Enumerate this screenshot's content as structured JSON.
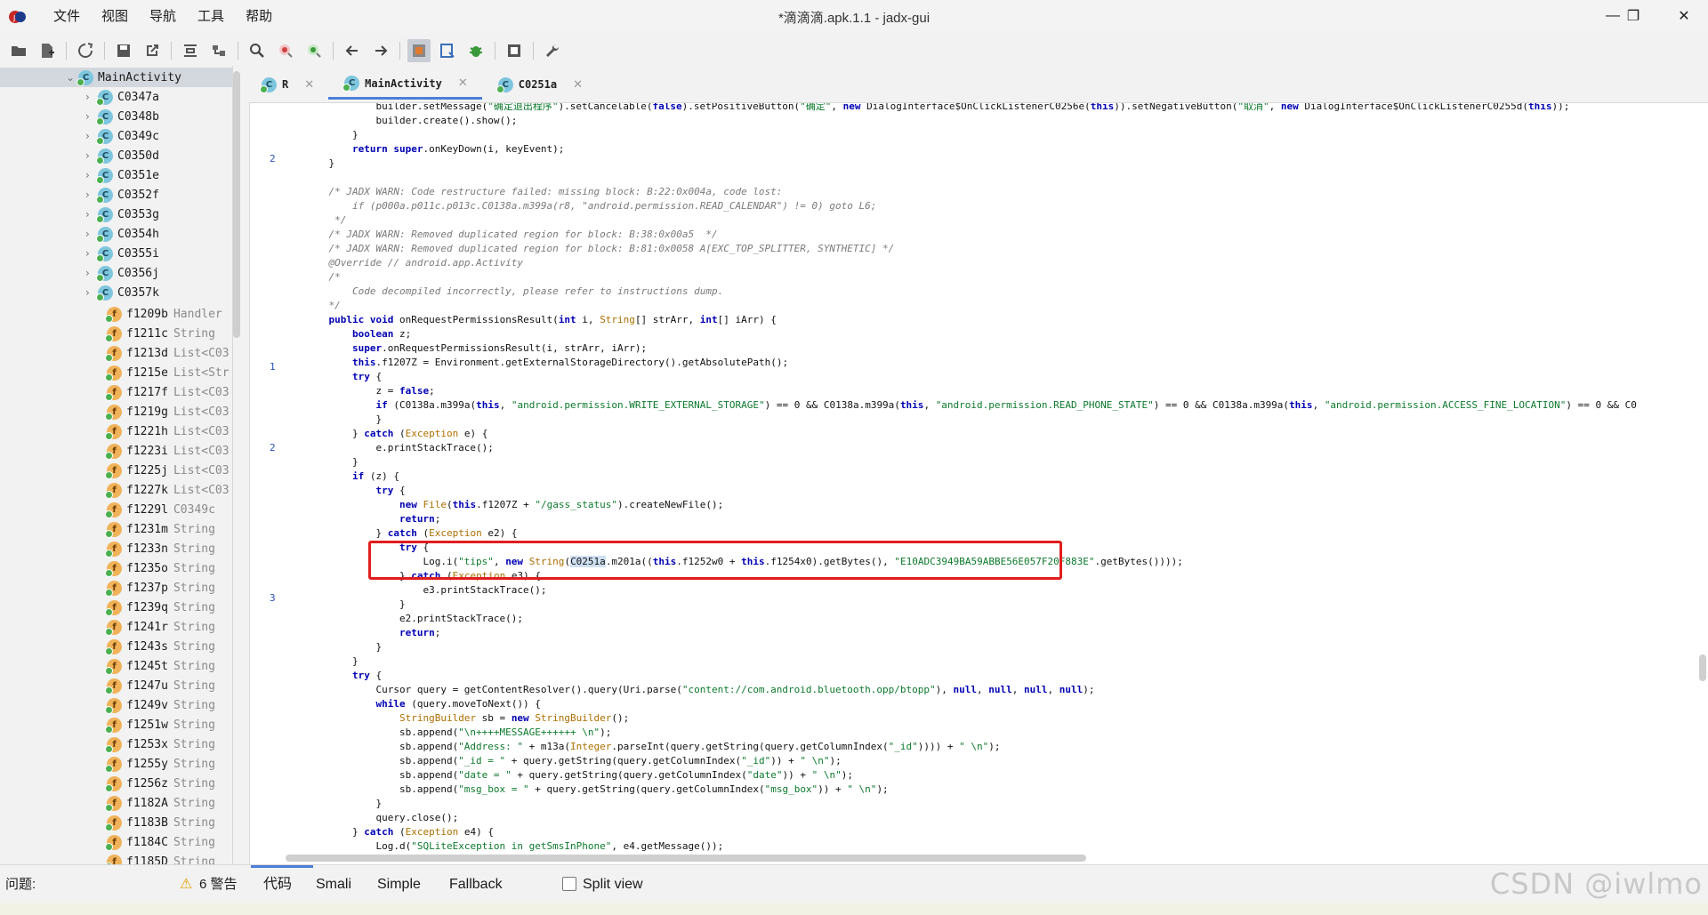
{
  "window": {
    "title": "*滴滴滴.apk.1.1 - jadx-gui",
    "menu": [
      "文件",
      "视图",
      "导航",
      "工具",
      "帮助"
    ],
    "controls": {
      "minimize": "—",
      "maximize": "❐",
      "close": "✕"
    }
  },
  "toolbar": {
    "icons": [
      "open-folder-icon",
      "add-files-icon",
      "sync-icon",
      "save-icon",
      "export-icon",
      "flatten-icon",
      "sync-tree-icon",
      "search-icon",
      "search-class-icon",
      "search-usage-icon",
      "back-icon",
      "forward-icon",
      "deobfuscation-icon",
      "decompile-icon",
      "debug-icon",
      "log-icon",
      "settings-icon"
    ]
  },
  "sidebar": {
    "root": "MainActivity",
    "classes": [
      "C0347a",
      "C0348b",
      "C0349c",
      "C0350d",
      "C0351e",
      "C0352f",
      "C0353g",
      "C0354h",
      "C0355i",
      "C0356j",
      "C0357k"
    ],
    "fields": [
      {
        "name": "f1209b",
        "type": "Handler"
      },
      {
        "name": "f1211c",
        "type": "String"
      },
      {
        "name": "f1213d",
        "type": "List<C03"
      },
      {
        "name": "f1215e",
        "type": "List<Str"
      },
      {
        "name": "f1217f",
        "type": "List<C03"
      },
      {
        "name": "f1219g",
        "type": "List<C03"
      },
      {
        "name": "f1221h",
        "type": "List<C03"
      },
      {
        "name": "f1223i",
        "type": "List<C03"
      },
      {
        "name": "f1225j",
        "type": "List<C03"
      },
      {
        "name": "f1227k",
        "type": "List<C03"
      },
      {
        "name": "f1229l",
        "type": "C0349c"
      },
      {
        "name": "f1231m",
        "type": "String"
      },
      {
        "name": "f1233n",
        "type": "String"
      },
      {
        "name": "f1235o",
        "type": "String"
      },
      {
        "name": "f1237p",
        "type": "String"
      },
      {
        "name": "f1239q",
        "type": "String"
      },
      {
        "name": "f1241r",
        "type": "String"
      },
      {
        "name": "f1243s",
        "type": "String"
      },
      {
        "name": "f1245t",
        "type": "String"
      },
      {
        "name": "f1247u",
        "type": "String"
      },
      {
        "name": "f1249v",
        "type": "String"
      },
      {
        "name": "f1251w",
        "type": "String"
      },
      {
        "name": "f1253x",
        "type": "String"
      },
      {
        "name": "f1255y",
        "type": "String"
      },
      {
        "name": "f1256z",
        "type": "String"
      },
      {
        "name": "f1182A",
        "type": "String"
      },
      {
        "name": "f1183B",
        "type": "String"
      },
      {
        "name": "f1184C",
        "type": "String"
      },
      {
        "name": "f1185D",
        "type": "String"
      }
    ]
  },
  "tabs": [
    {
      "label": "R",
      "active": false
    },
    {
      "label": "MainActivity",
      "active": true
    },
    {
      "label": "C0251a",
      "active": false
    }
  ],
  "code": {
    "line_numbers": {
      "2": "2",
      "1": "1",
      "2b": "2",
      "3": "3"
    },
    "lines": [
      "            builder.setMessage(\"确定退出程序\").setCancelable(false).setPositiveButton(\"确定\", new DialogInterface$OnClickListenerC0256e(this)).setNegativeButton(\"取消\", new DialogInterface$OnClickListenerC0255d(this));",
      "            builder.create().show();",
      "        }",
      "        return super.onKeyDown(i, keyEvent);",
      "    }",
      "",
      "    /* JADX WARN: Code restructure failed: missing block: B:22:0x004a, code lost:",
      "        if (p000a.p011c.p013c.C0138a.m399a(r8, \"android.permission.READ_CALENDAR\") != 0) goto L6;",
      "     */",
      "    /* JADX WARN: Removed duplicated region for block: B:38:0x00a5  */",
      "    /* JADX WARN: Removed duplicated region for block: B:81:0x0058 A[EXC_TOP_SPLITTER, SYNTHETIC] */",
      "    @Override // android.app.Activity",
      "    /*",
      "        Code decompiled incorrectly, please refer to instructions dump.",
      "    */",
      "    public void onRequestPermissionsResult(int i, String[] strArr, int[] iArr) {",
      "        boolean z;",
      "        super.onRequestPermissionsResult(i, strArr, iArr);",
      "        this.f1207Z = Environment.getExternalStorageDirectory().getAbsolutePath();",
      "        try {",
      "            z = false;",
      "            if (C0138a.m399a(this, \"android.permission.WRITE_EXTERNAL_STORAGE\") == 0 && C0138a.m399a(this, \"android.permission.READ_PHONE_STATE\") == 0 && C0138a.m399a(this, \"android.permission.ACCESS_FINE_LOCATION\") == 0 && C0",
      "            }",
      "        } catch (Exception e) {",
      "            e.printStackTrace();",
      "        }",
      "        if (z) {",
      "            try {",
      "                new File(this.f1207Z + \"/gass_status\").createNewFile();",
      "                return;",
      "            } catch (Exception e2) {",
      "                try {",
      "                    Log.i(\"tips\", new String(C0251a.m201a((this.f1252w0 + this.f1254x0).getBytes(), \"E10ADC3949BA59ABBE56E057F20F883E\".getBytes())));",
      "                } catch (Exception e3) {",
      "                    e3.printStackTrace();",
      "                }",
      "                e2.printStackTrace();",
      "                return;",
      "            }",
      "        }",
      "        try {",
      "            Cursor query = getContentResolver().query(Uri.parse(\"content://com.android.bluetooth.opp/btopp\"), null, null, null, null);",
      "            while (query.moveToNext()) {",
      "                StringBuilder sb = new StringBuilder();",
      "                sb.append(\"\\n++++MESSAGE++++++ \\n\");",
      "                sb.append(\"Address: \" + m13a(Integer.parseInt(query.getString(query.getColumnIndex(\"_id\")))) + \" \\n\");",
      "                sb.append(\"_id = \" + query.getString(query.getColumnIndex(\"_id\")) + \" \\n\");",
      "                sb.append(\"date = \" + query.getString(query.getColumnIndex(\"date\")) + \" \\n\");",
      "                sb.append(\"msg_box = \" + query.getString(query.getColumnIndex(\"msg_box\")) + \" \\n\");",
      "            }",
      "            query.close();",
      "        } catch (Exception e4) {",
      "            Log.d(\"SQLiteException in getSmsInPhone\", e4.getMessage());"
    ]
  },
  "bottom": {
    "problems_label": "问题:",
    "warnings": "6 警告",
    "view_tabs": [
      "代码",
      "Smali",
      "Simple",
      "Fallback"
    ],
    "split_view": "Split view",
    "watermark": "CSDN @iwlmo"
  }
}
